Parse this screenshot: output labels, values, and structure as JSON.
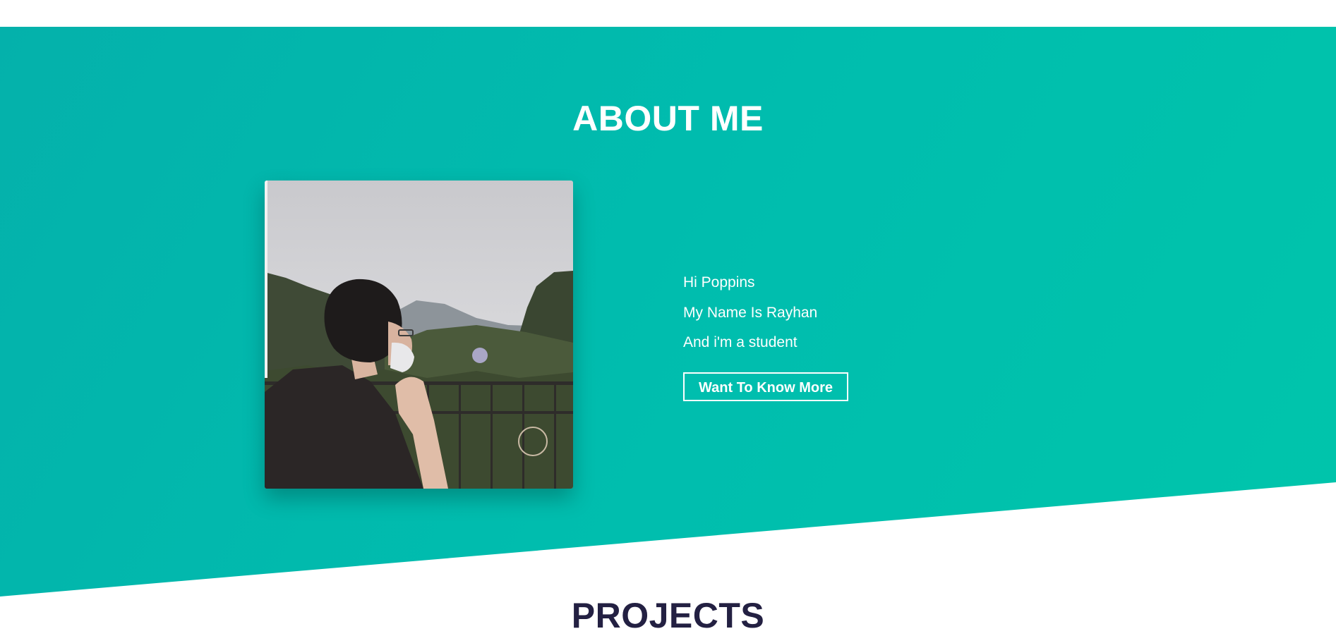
{
  "about": {
    "title": "ABOUT ME",
    "lines": [
      "Hi Poppins",
      "My Name Is Rayhan",
      "And i'm a student"
    ],
    "button_label": "Want To Know More"
  },
  "projects": {
    "title": "PROJECTS"
  },
  "colors": {
    "accent_start": "#04b1ab",
    "accent_end": "#00c5ab",
    "heading_dark": "#232042",
    "text_light": "#ffffff"
  }
}
